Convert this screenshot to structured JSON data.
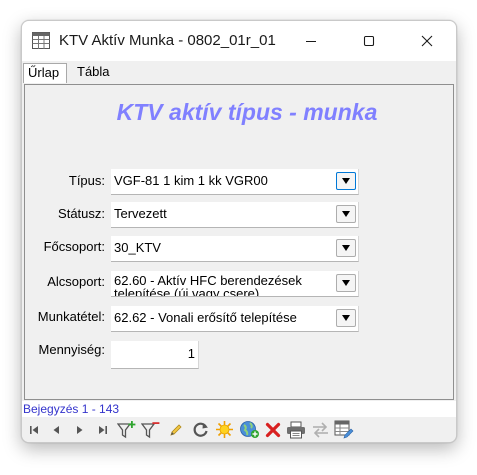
{
  "window": {
    "title": "KTV Aktív Munka - 0802_01r_01"
  },
  "tabs": [
    {
      "label": "Űrlap",
      "active": true
    },
    {
      "label": "Tábla",
      "active": false
    }
  ],
  "form": {
    "heading": "KTV aktív típus - munka",
    "fields": {
      "tipus": {
        "label": "Típus:",
        "value": "VGF-81 1 kim 1 kk VGR00"
      },
      "statusz": {
        "label": "Státusz:",
        "value": "Tervezett"
      },
      "focsoport": {
        "label": "Főcsoport:",
        "value": "30_KTV"
      },
      "alcsoport": {
        "label": "Alcsoport:",
        "value": "62.60 - Aktív HFC berendezések telepítése (új vagy csere)"
      },
      "munkatetel": {
        "label": "Munkatétel:",
        "value": "62.62 - Vonali erősítő telepítése"
      },
      "mennyiseg": {
        "label": "Mennyiség:",
        "value": "1"
      }
    }
  },
  "status": {
    "record_text": "Bejegyzés 1 - 143"
  },
  "colors": {
    "heading": "#8080ff",
    "status_text": "#3333cc",
    "focus_border": "#0078d7"
  },
  "toolbar": {
    "icons": [
      "first-record-icon",
      "previous-record-icon",
      "next-record-icon",
      "last-record-icon",
      "add-filter-icon",
      "remove-filter-icon",
      "edit-pencil-icon",
      "refresh-icon",
      "new-record-icon",
      "web-globe-icon",
      "delete-icon",
      "print-icon",
      "transfer-icon",
      "table-edit-icon"
    ]
  }
}
